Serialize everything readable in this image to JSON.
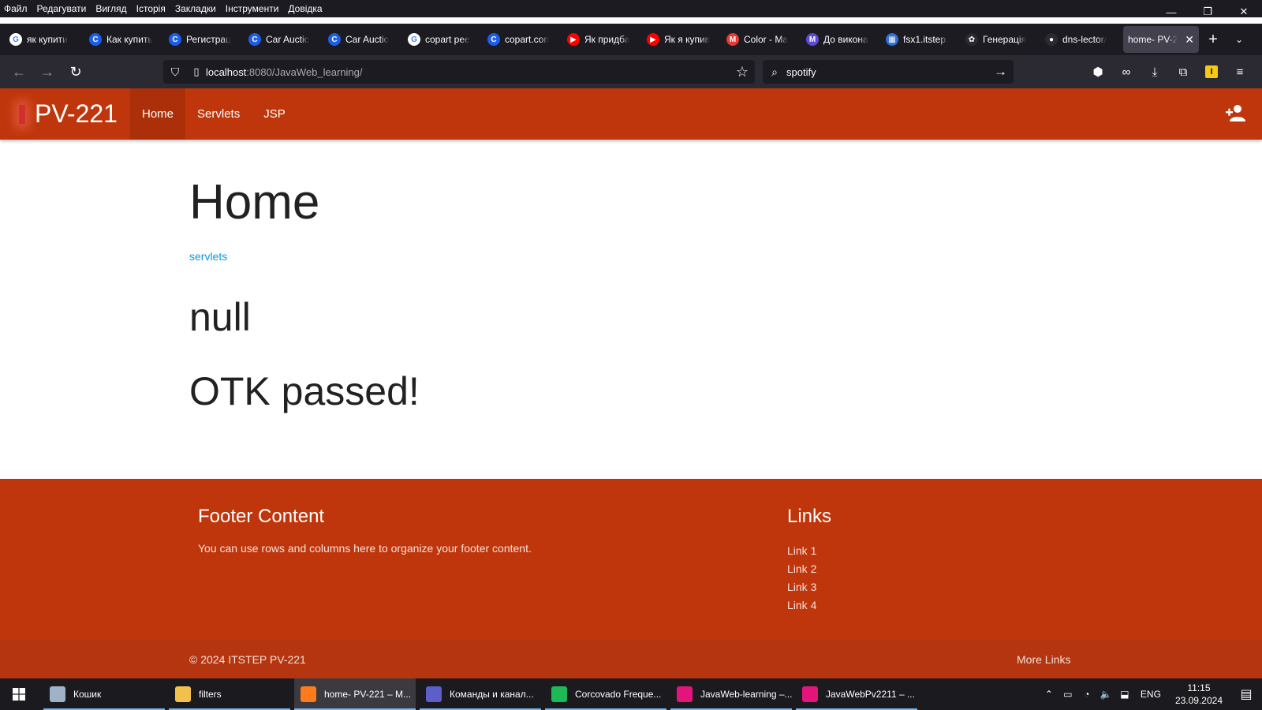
{
  "browser": {
    "menu": [
      "Файл",
      "Редагувати",
      "Вигляд",
      "Історія",
      "Закладки",
      "Інструменти",
      "Довідка"
    ],
    "tabs": [
      {
        "label": "як купити",
        "icon": "google-icon",
        "color": "#ffffff",
        "glyph": "G"
      },
      {
        "label": "Как купить",
        "icon": "copart-icon",
        "color": "#1d5ee8",
        "glyph": "C"
      },
      {
        "label": "Регистрац",
        "icon": "copart-icon",
        "color": "#1d5ee8",
        "glyph": "C"
      },
      {
        "label": "Car Auctio",
        "icon": "copart-icon",
        "color": "#1d5ee8",
        "glyph": "C"
      },
      {
        "label": "Car Auctio",
        "icon": "copart-icon",
        "color": "#1d5ee8",
        "glyph": "C"
      },
      {
        "label": "copart рее",
        "icon": "google-icon",
        "color": "#ffffff",
        "glyph": "G"
      },
      {
        "label": "copart.con",
        "icon": "copart-icon",
        "color": "#1d5ee8",
        "glyph": "C"
      },
      {
        "label": "Як придба",
        "icon": "youtube-icon",
        "color": "#ff0000",
        "glyph": "▶"
      },
      {
        "label": "Як я купив",
        "icon": "youtube-icon",
        "color": "#ff0000",
        "glyph": "▶"
      },
      {
        "label": "Color - Ma",
        "icon": "material-icon",
        "color": "#e53935",
        "glyph": "M"
      },
      {
        "label": "До викона",
        "icon": "m-icon",
        "color": "#5b4bd8",
        "glyph": "M"
      },
      {
        "label": "fsx1.itstep.",
        "icon": "chart-icon",
        "color": "#2f6fd6",
        "glyph": "▦"
      },
      {
        "label": "Генерація",
        "icon": "openai-icon",
        "color": "#2b2a33",
        "glyph": "✿"
      },
      {
        "label": "dns-lector/",
        "icon": "github-icon",
        "color": "#2b2a33",
        "glyph": "●"
      }
    ],
    "active_tab": {
      "label": "home- PV-2",
      "close": "✕"
    },
    "url_host": "localhost",
    "url_path": ":8080/JavaWeb_learning/",
    "search_value": "spotify",
    "colors": {
      "chrome_dark": "#1c1b22",
      "toolbar": "#2b2a33"
    }
  },
  "site": {
    "brand": "PV-221",
    "nav": [
      {
        "label": "Home",
        "active": true
      },
      {
        "label": "Servlets",
        "active": false
      },
      {
        "label": "JSP",
        "active": false
      }
    ],
    "title": "Home",
    "servlets_link": "servlets",
    "null_text": "null",
    "otk_text": "OTK passed!",
    "footer": {
      "heading": "Footer Content",
      "text": "You can use rows and columns here to organize your footer content.",
      "links_heading": "Links",
      "links": [
        "Link 1",
        "Link 2",
        "Link 3",
        "Link 4"
      ],
      "copyright": "© 2024 ITSTEP PV-221",
      "more_links": "More Links"
    },
    "colors": {
      "primary": "#bf360c",
      "link": "#039be5"
    }
  },
  "taskbar": {
    "apps": [
      {
        "label": "Кошик",
        "icon": "recycle-bin-icon",
        "color": "#9fb3c8",
        "active": false
      },
      {
        "label": "filters",
        "icon": "folder-icon",
        "color": "#f3c14b",
        "active": false
      },
      {
        "label": "home- PV-221 – M...",
        "icon": "firefox-icon",
        "color": "#ff7a1a",
        "active": true
      },
      {
        "label": "Команды и канал...",
        "icon": "teams-icon",
        "color": "#5b5fc7",
        "active": false
      },
      {
        "label": "Corcovado Freque...",
        "icon": "spotify-icon",
        "color": "#1db954",
        "active": false
      },
      {
        "label": "JavaWeb-learning –...",
        "icon": "intellij-icon",
        "color": "#e4157a",
        "active": false
      },
      {
        "label": "JavaWebPv2211 – ...",
        "icon": "intellij-icon",
        "color": "#e4157a",
        "active": false
      }
    ],
    "lang": "ENG",
    "time": "11:15",
    "date": "23.09.2024"
  }
}
